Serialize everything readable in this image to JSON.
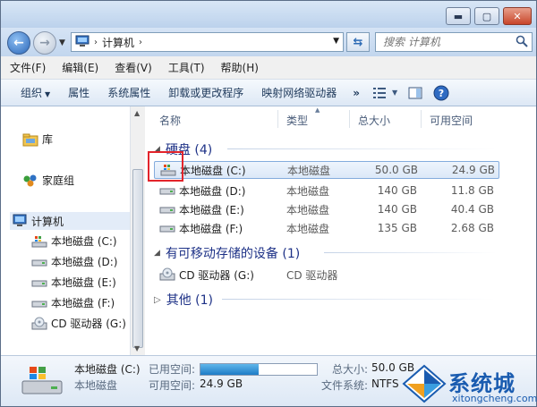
{
  "window": {
    "controls": {
      "minimize": "▬",
      "maximize": "▢",
      "close": "✕"
    }
  },
  "address": {
    "root_glyph": "›",
    "crumb": "计算机",
    "crumb_sep": "›",
    "search_placeholder": "搜索 计算机"
  },
  "menu": [
    "文件(F)",
    "编辑(E)",
    "查看(V)",
    "工具(T)",
    "帮助(H)"
  ],
  "toolbar": {
    "organize": "组织",
    "properties": "属性",
    "system_properties": "系统属性",
    "uninstall": "卸载或更改程序",
    "map_drive": "映射网络驱动器",
    "more": "»"
  },
  "nav": {
    "library": "库",
    "homegroup": "家庭组",
    "computer": "计算机",
    "drives": [
      "本地磁盘 (C:)",
      "本地磁盘 (D:)",
      "本地磁盘 (E:)",
      "本地磁盘 (F:)",
      "CD 驱动器 (G:)"
    ]
  },
  "columns": {
    "name": "名称",
    "type": "类型",
    "total": "总大小",
    "free": "可用空间"
  },
  "groups": {
    "hdd": "硬盘 (4)",
    "removable": "有可移动存储的设备 (1)",
    "other": "其他 (1)"
  },
  "disks": [
    {
      "name": "本地磁盘 (C:)",
      "type": "本地磁盘",
      "total": "50.0 GB",
      "free": "24.9 GB"
    },
    {
      "name": "本地磁盘 (D:)",
      "type": "本地磁盘",
      "total": "140 GB",
      "free": "11.8 GB"
    },
    {
      "name": "本地磁盘 (E:)",
      "type": "本地磁盘",
      "total": "140 GB",
      "free": "40.4 GB"
    },
    {
      "name": "本地磁盘 (F:)",
      "type": "本地磁盘",
      "total": "135 GB",
      "free": "2.68 GB"
    }
  ],
  "removable": [
    {
      "name": "CD 驱动器 (G:)",
      "type": "CD 驱动器"
    }
  ],
  "details": {
    "name": "本地磁盘 (C:)",
    "type": "本地磁盘",
    "used_label": "已用空间:",
    "free_label": "可用空间:",
    "free_value": "24.9 GB",
    "total_label": "总大小:",
    "total_value": "50.0 GB",
    "fs_label": "文件系统:",
    "fs_value": "NTFS",
    "used_fraction": 0.5
  },
  "watermark": {
    "text": "系统城",
    "url": "xitongcheng.com"
  },
  "colors": {
    "accent": "#1e3287",
    "selection_border": "#84acdd",
    "highlight_box": "#e3242b"
  }
}
